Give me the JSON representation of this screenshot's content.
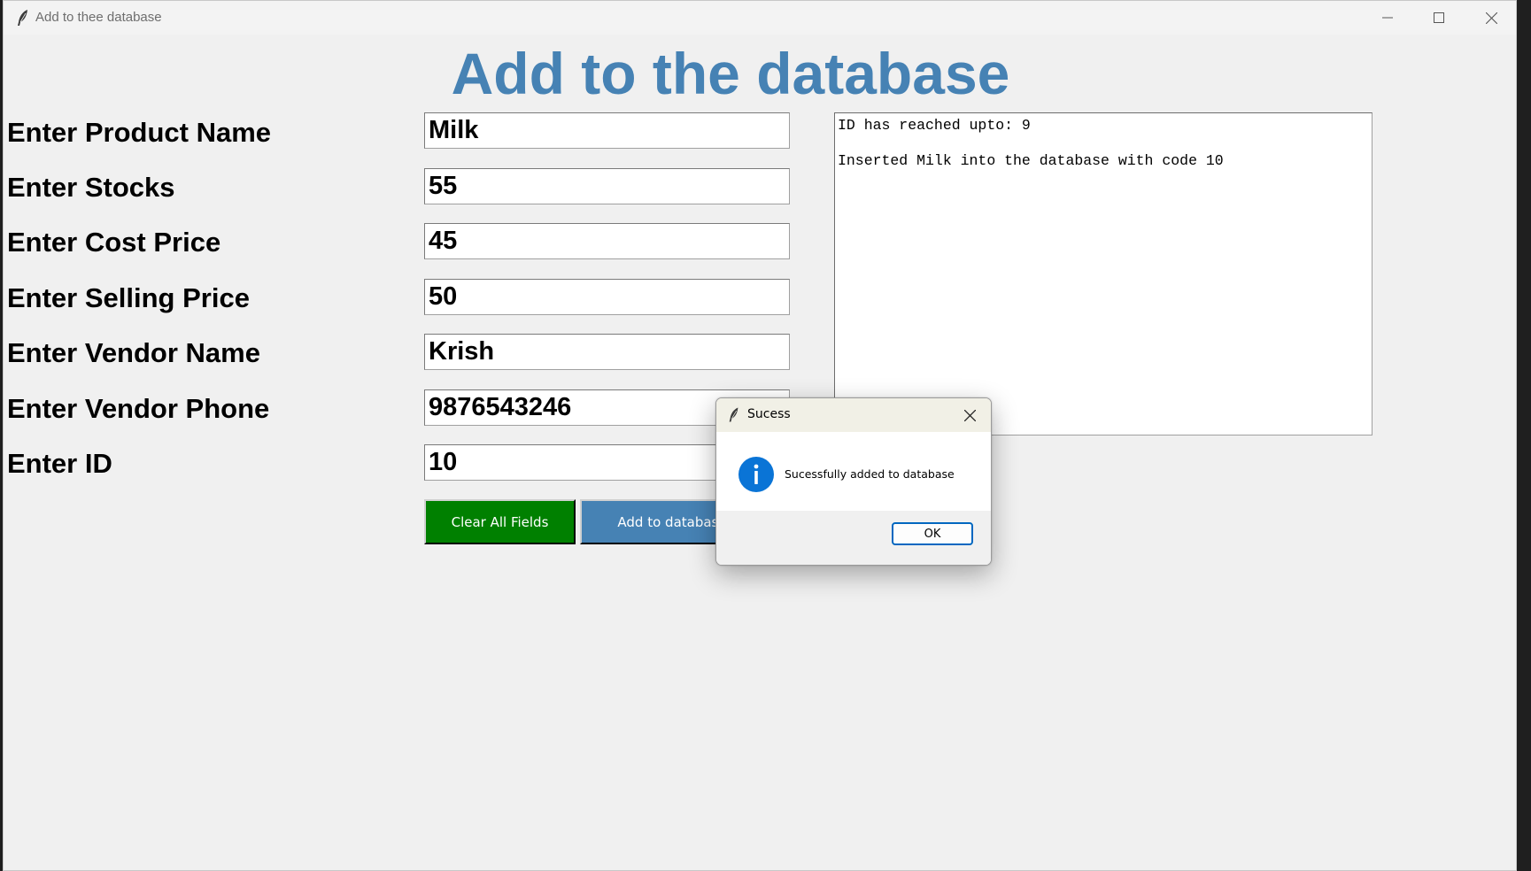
{
  "window": {
    "title": "Add to thee database",
    "icon": "feather-icon",
    "controls": [
      "minimize-icon",
      "maximize-icon",
      "close-icon"
    ]
  },
  "heading": "Add to the database",
  "form": {
    "fields": [
      {
        "label": "Enter Product Name",
        "value": "Milk"
      },
      {
        "label": "Enter Stocks",
        "value": "55"
      },
      {
        "label": "Enter Cost Price",
        "value": "45"
      },
      {
        "label": "Enter Selling Price",
        "value": "50"
      },
      {
        "label": "Enter Vendor Name",
        "value": "Krish"
      },
      {
        "label": "Enter Vendor Phone",
        "value": "9876543246"
      },
      {
        "label": "Enter ID",
        "value": "10"
      }
    ],
    "clear_button": "Clear All Fields",
    "add_button": "Add to database"
  },
  "log": {
    "lines": [
      "ID has reached upto: 9",
      "",
      "Inserted Milk into the database with code 10"
    ]
  },
  "dialog": {
    "title": "Sucess",
    "icon": "info-icon",
    "message": "Sucessfully added to database",
    "ok_label": "OK"
  },
  "colors": {
    "heading": "#4682b4",
    "clear_button_bg": "#008000",
    "add_button_bg": "#4682b4",
    "window_bg": "#f0f0f0",
    "dialog_accent": "#0067c0"
  }
}
